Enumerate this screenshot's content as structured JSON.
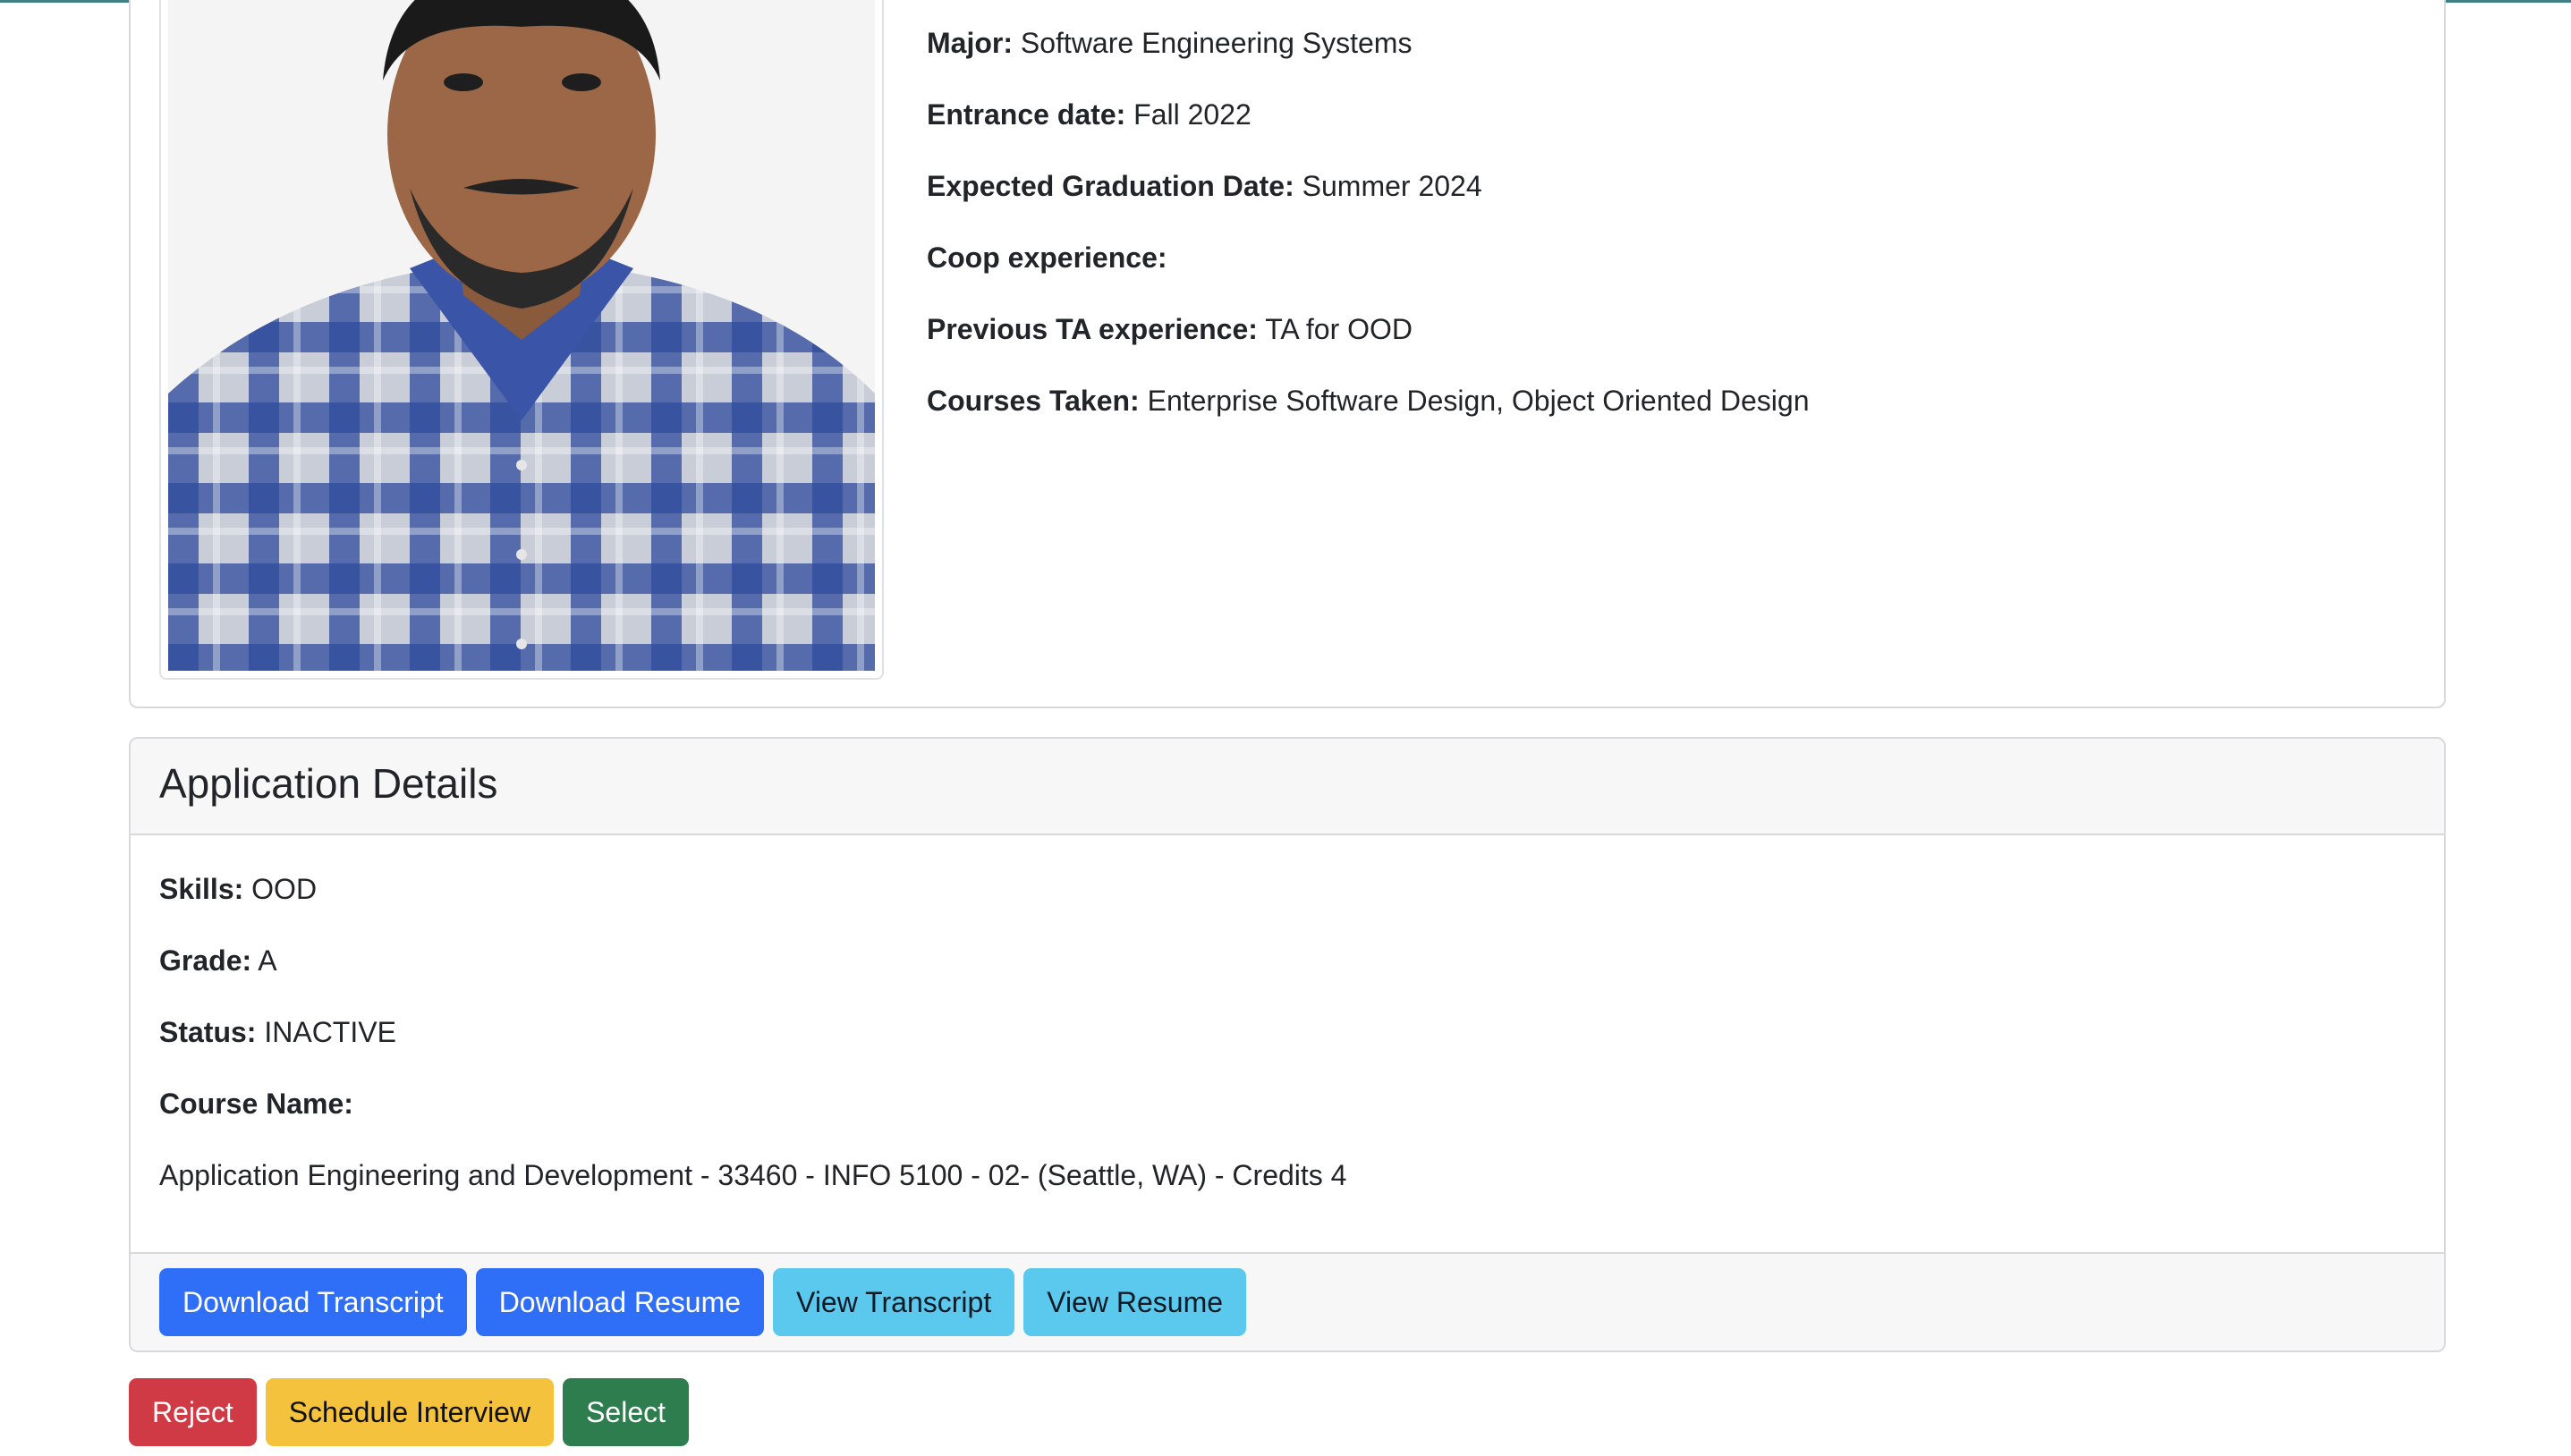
{
  "profile": {
    "photo_alt": "Applicant photo",
    "fields": [
      {
        "label": "Major:",
        "value": "Software Engineering Systems"
      },
      {
        "label": "Entrance date:",
        "value": "Fall 2022"
      },
      {
        "label": "Expected Graduation Date:",
        "value": "Summer 2024"
      },
      {
        "label": "Coop experience:",
        "value": ""
      },
      {
        "label": "Previous TA experience:",
        "value": "TA for OOD"
      },
      {
        "label": "Courses Taken:",
        "value": "Enterprise Software Design, Object Oriented Design"
      }
    ]
  },
  "application": {
    "title": "Application Details",
    "skills_label": "Skills:",
    "skills_value": "OOD",
    "grade_label": "Grade:",
    "grade_value": "A",
    "status_label": "Status:",
    "status_value": "INACTIVE",
    "course_label": "Course Name:",
    "course_value": "Application Engineering and Development - 33460 - INFO 5100 - 02- (Seattle, WA) - Credits 4",
    "buttons": {
      "download_transcript": "Download Transcript",
      "download_resume": "Download Resume",
      "view_transcript": "View Transcript",
      "view_resume": "View Resume"
    }
  },
  "decision": {
    "reject": "Reject",
    "schedule": "Schedule Interview",
    "select": "Select"
  },
  "colors": {
    "primary": "#2f6ef7",
    "info": "#5bc8ee",
    "danger": "#d03a45",
    "warning": "#f5c23e",
    "success": "#2e7d4f"
  }
}
